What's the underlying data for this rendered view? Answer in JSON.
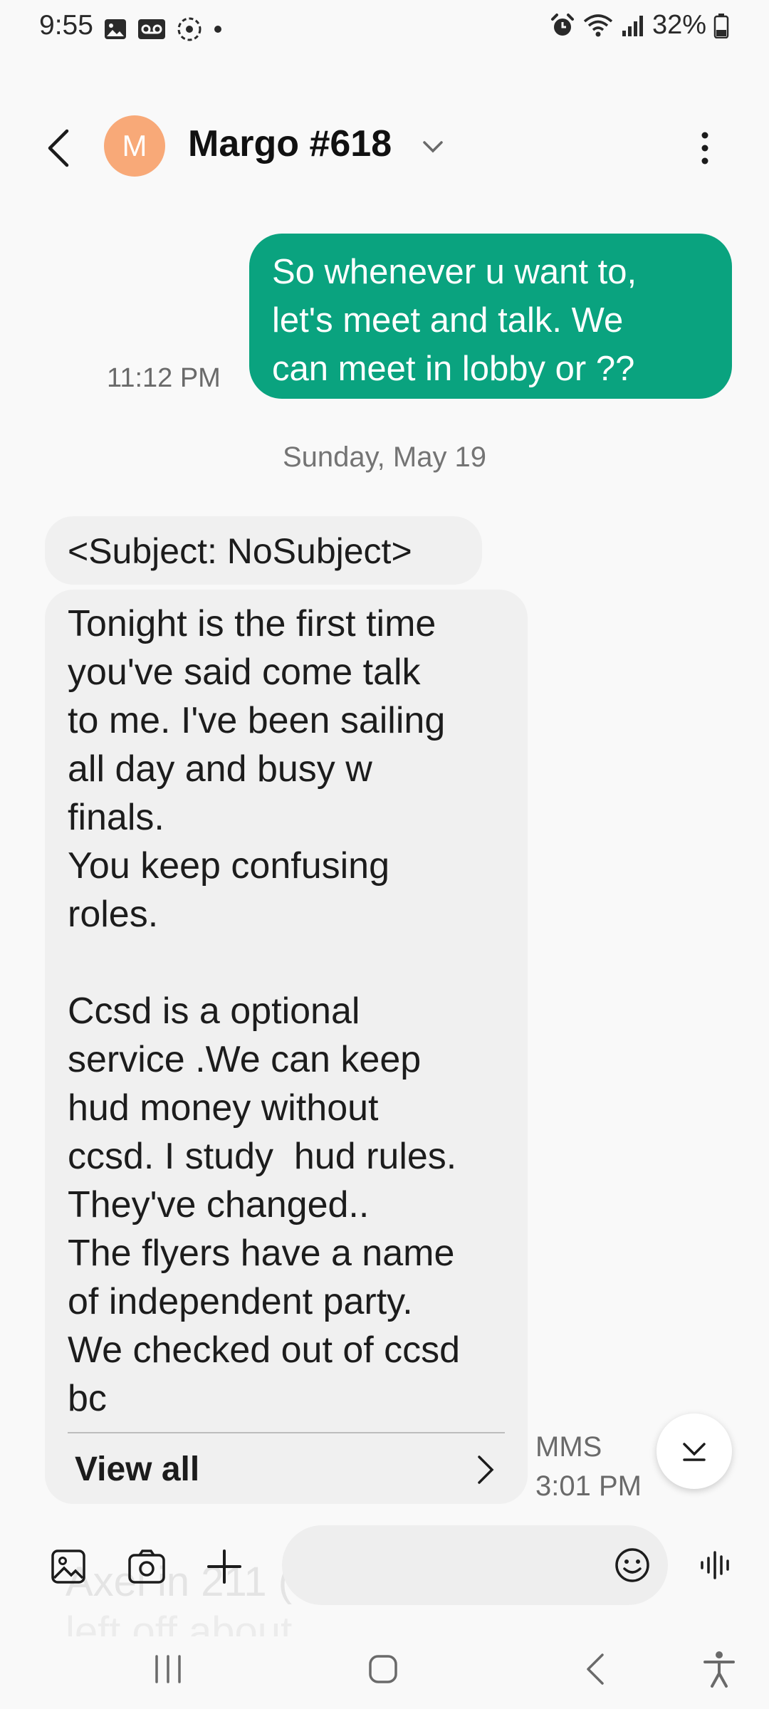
{
  "status_bar": {
    "time": "9:55",
    "battery": "32%",
    "icons": [
      "image-icon",
      "voicemail-icon",
      "sync-icon",
      "dot-icon",
      "alarm-icon",
      "wifi-icon",
      "signal-icon",
      "battery-icon"
    ]
  },
  "header": {
    "avatar_letter": "M",
    "avatar_color": "#f8a978",
    "contact_name": "Margo #618"
  },
  "messages": {
    "outgoing": {
      "text": "So whenever u want to,\nlet's meet and talk. We\ncan meet in lobby or ??",
      "time": "11:12 PM",
      "bubble_color": "#0aa37f"
    },
    "date_separator": "Sunday, May 19",
    "incoming": {
      "subject": "<Subject: NoSubject>",
      "text": "Tonight is the first time\nyou've said come talk\nto me. I've been sailing\nall day and busy w\nfinals.\nYou keep confusing\nroles.\n\nCcsd is a optional\nservice .We can keep\nhud money without\nccsd. I study  hud rules.\nThey've changed..\nThe flyers have a name\nof independent party.\nWe checked out of ccsd\nbc",
      "view_all": "View all",
      "type": "MMS",
      "time": "3:01 PM"
    }
  },
  "composer": {
    "ghost_text": "Axel in 211 (",
    "ghost_text_2": "left off about"
  }
}
